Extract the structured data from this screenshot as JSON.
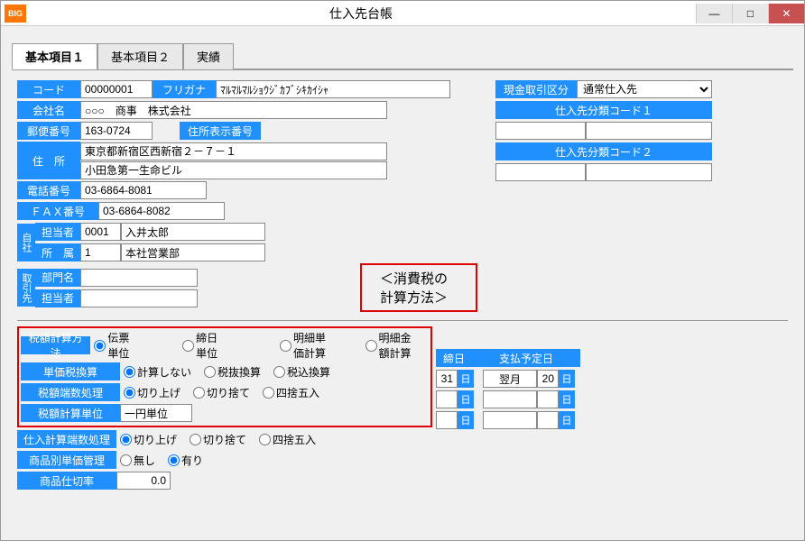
{
  "window": {
    "icon": "BIG",
    "title": "仕入先台帳"
  },
  "tabs": {
    "t1": "基本項目１",
    "t2": "基本項目２",
    "t3": "実績"
  },
  "labels": {
    "code": "コード",
    "furigana": "フリガナ",
    "company": "会社名",
    "zip": "郵便番号",
    "addrbtn": "住所表示番号",
    "address": "住　所",
    "tel": "電話番号",
    "fax": "ＦＡＸ番号",
    "self": "自社",
    "person": "担当者",
    "dept": "所　属",
    "tori": "取引先",
    "deptname": "部門名",
    "toriperson": "担当者",
    "cashdiv": "現金取引区分",
    "class1": "仕入先分類コード１",
    "class2": "仕入先分類コード２",
    "taxcalc": "税額計算方法",
    "unitcalc": "単価税換算",
    "taxround": "税額端数処理",
    "taxunit": "税額計算単位",
    "purround": "仕入計算端数処理",
    "itemprice": "商品別単価管理",
    "cutrate": "商品仕切率",
    "closeday": "締日",
    "paydate": "支払予定日",
    "day": "日"
  },
  "values": {
    "code": "00000001",
    "furigana": "ﾏﾙﾏﾙﾏﾙｼｮｳｼﾞｶﾌﾞｼｷｶｲｼｬ",
    "company": "○○○　商事　株式会社",
    "zip": "163-0724",
    "addr1": "東京都新宿区西新宿２－７－１",
    "addr2": "小田急第一生命ビル",
    "tel": "03-6864-8081",
    "fax": "03-6864-8082",
    "personcode": "0001",
    "personname": "入井太郎",
    "deptcode": "1",
    "deptname": "本社営業部",
    "cashdiv": "通常仕入先",
    "taxunit": "一円単位",
    "closeday": "31",
    "paymonth": "翌月",
    "payday": "20",
    "cutrate": "0.0"
  },
  "radios": {
    "taxcalc": {
      "r1": "伝票単位",
      "r2": "締日単位",
      "r3": "明細単価計算",
      "r4": "明細金額計算"
    },
    "unitcalc": {
      "r1": "計算しない",
      "r2": "税抜換算",
      "r3": "税込換算"
    },
    "round": {
      "r1": "切り上げ",
      "r2": "切り捨て",
      "r3": "四捨五入"
    },
    "itemprice": {
      "r1": "無し",
      "r2": "有り"
    }
  },
  "callout": "＜消費税の計算方法＞"
}
